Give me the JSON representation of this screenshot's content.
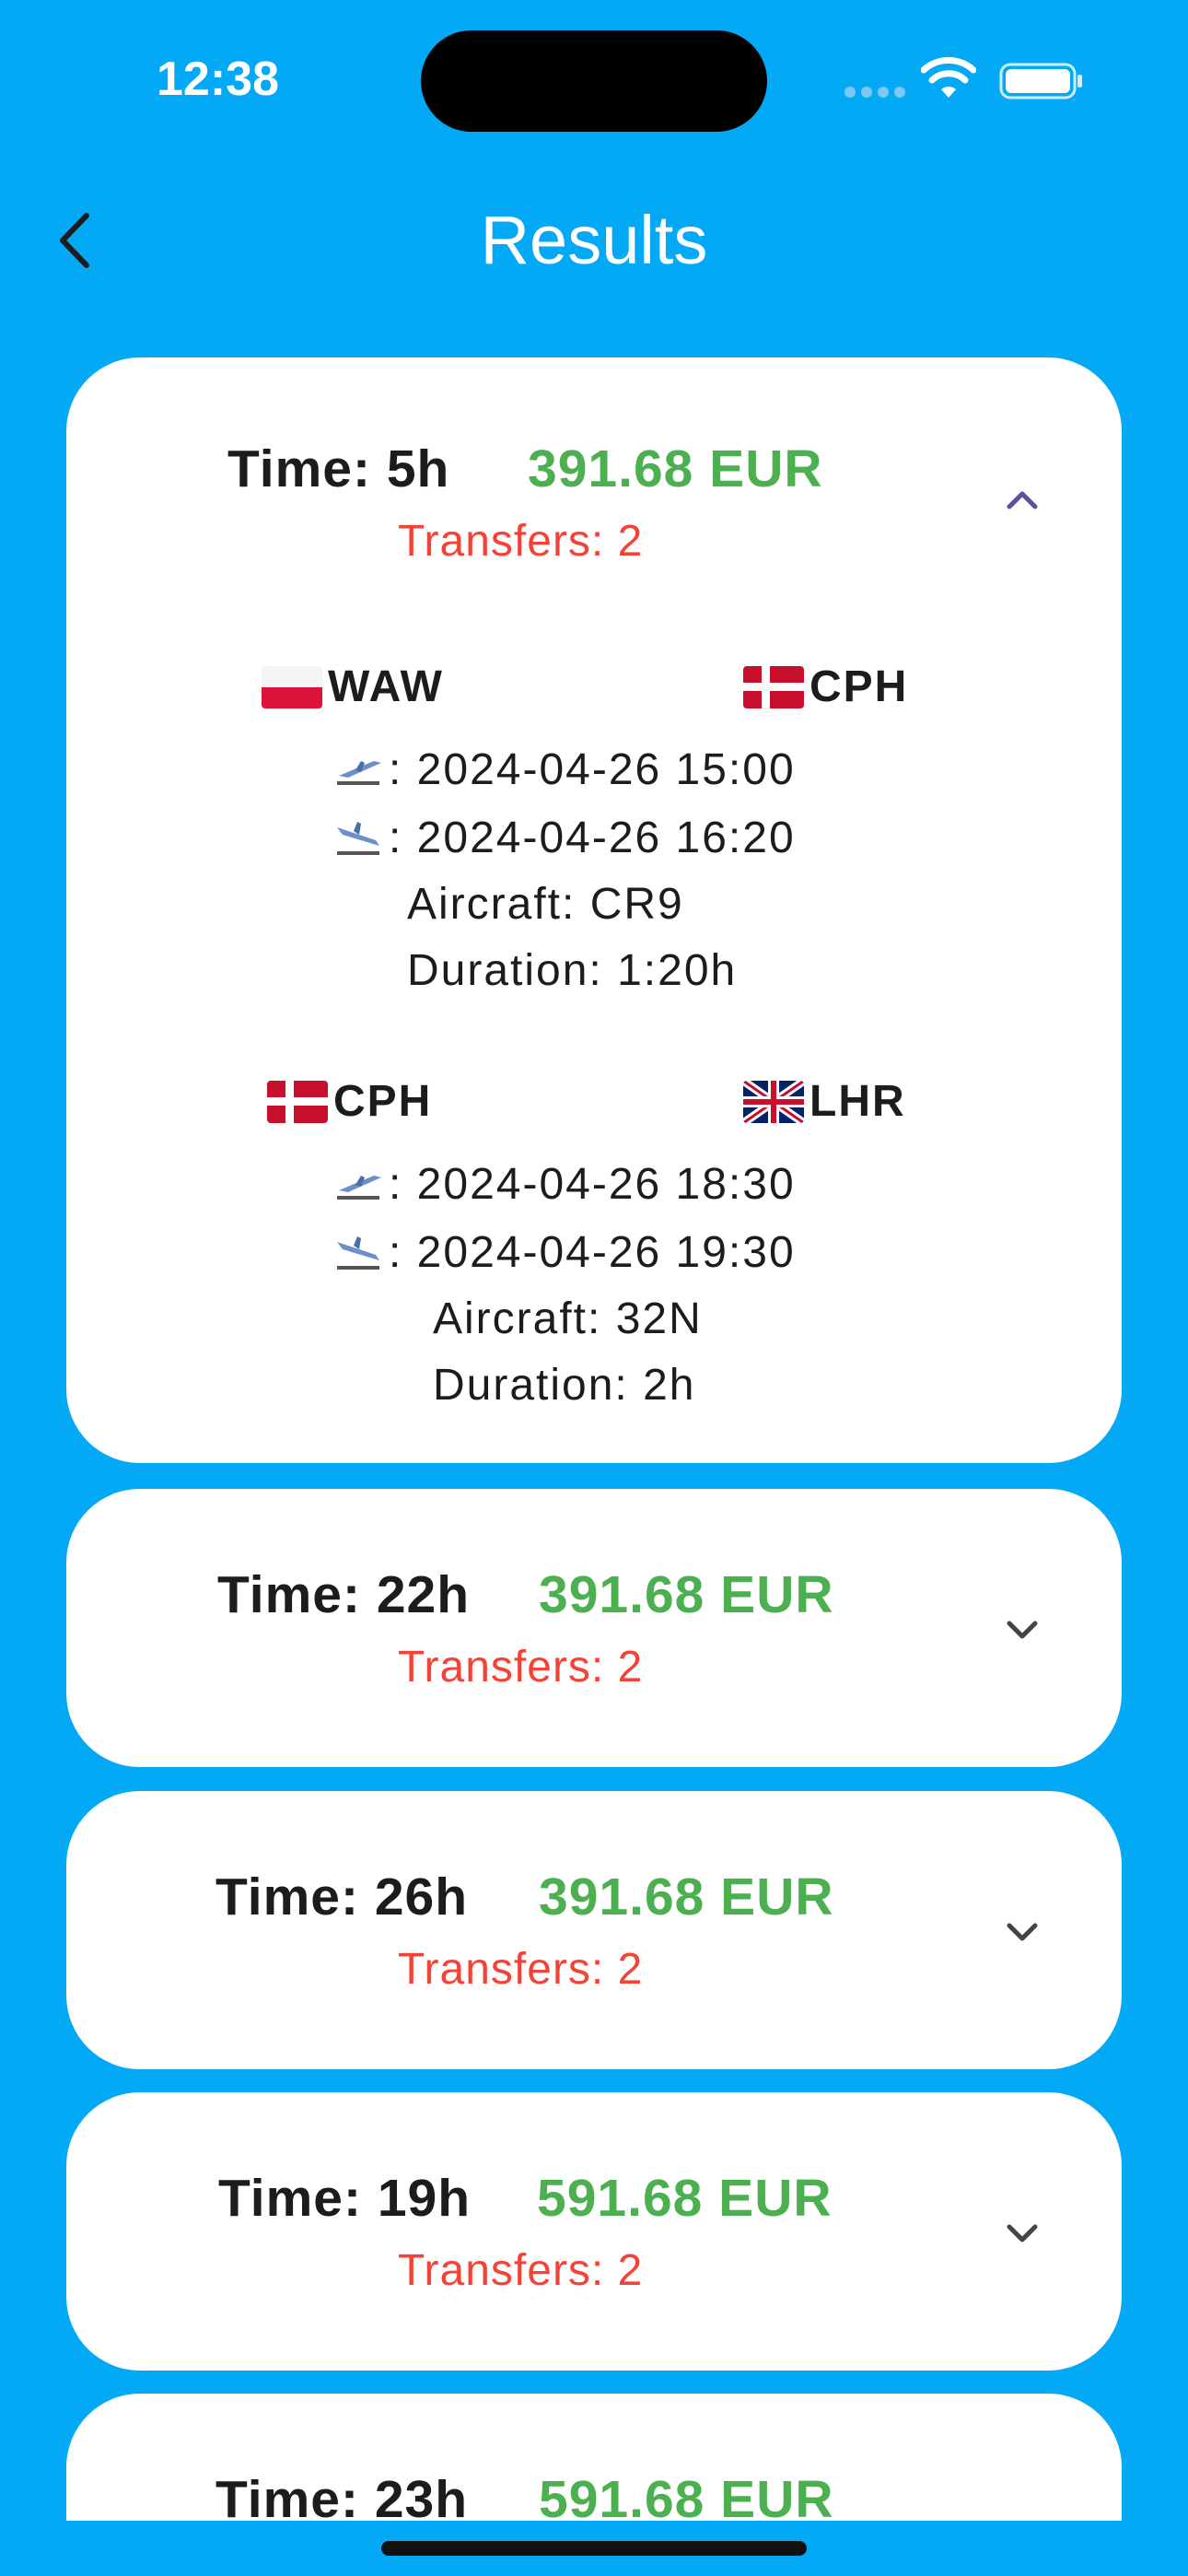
{
  "status": {
    "time": "12:38"
  },
  "header": {
    "title": "Results"
  },
  "results": [
    {
      "time": "Time: 5h",
      "price": "391.68 EUR",
      "transfers": "Transfers: 2",
      "expanded": true,
      "segments": [
        {
          "from": "WAW",
          "to": "CPH",
          "departure": ": 2024-04-26 15:00",
          "arrival": ": 2024-04-26 16:20",
          "aircraft": "Aircraft: CR9",
          "duration": "Duration: 1:20h"
        },
        {
          "from": "CPH",
          "to": "LHR",
          "departure": ": 2024-04-26 18:30",
          "arrival": ": 2024-04-26 19:30",
          "aircraft": "Aircraft: 32N",
          "duration": "Duration: 2h"
        }
      ]
    },
    {
      "time": "Time: 22h",
      "price": "391.68 EUR",
      "transfers": "Transfers: 2",
      "expanded": false
    },
    {
      "time": "Time: 26h",
      "price": "391.68 EUR",
      "transfers": "Transfers: 2",
      "expanded": false
    },
    {
      "time": "Time: 19h",
      "price": "591.68 EUR",
      "transfers": "Transfers: 2",
      "expanded": false
    },
    {
      "time": "Time: 23h",
      "price": "591.68 EUR",
      "transfers": "",
      "expanded": false
    }
  ],
  "colors": {
    "background": "#03A9F4",
    "price": "#4CAF50",
    "transfers": "#F44336",
    "card": "#FFFFFF"
  },
  "icons": {
    "back": "chevron-left-icon",
    "collapse": "chevron-up-icon",
    "expand": "chevron-down-icon",
    "departure": "airplane-departure-icon",
    "arrival": "airplane-arrival-icon"
  }
}
